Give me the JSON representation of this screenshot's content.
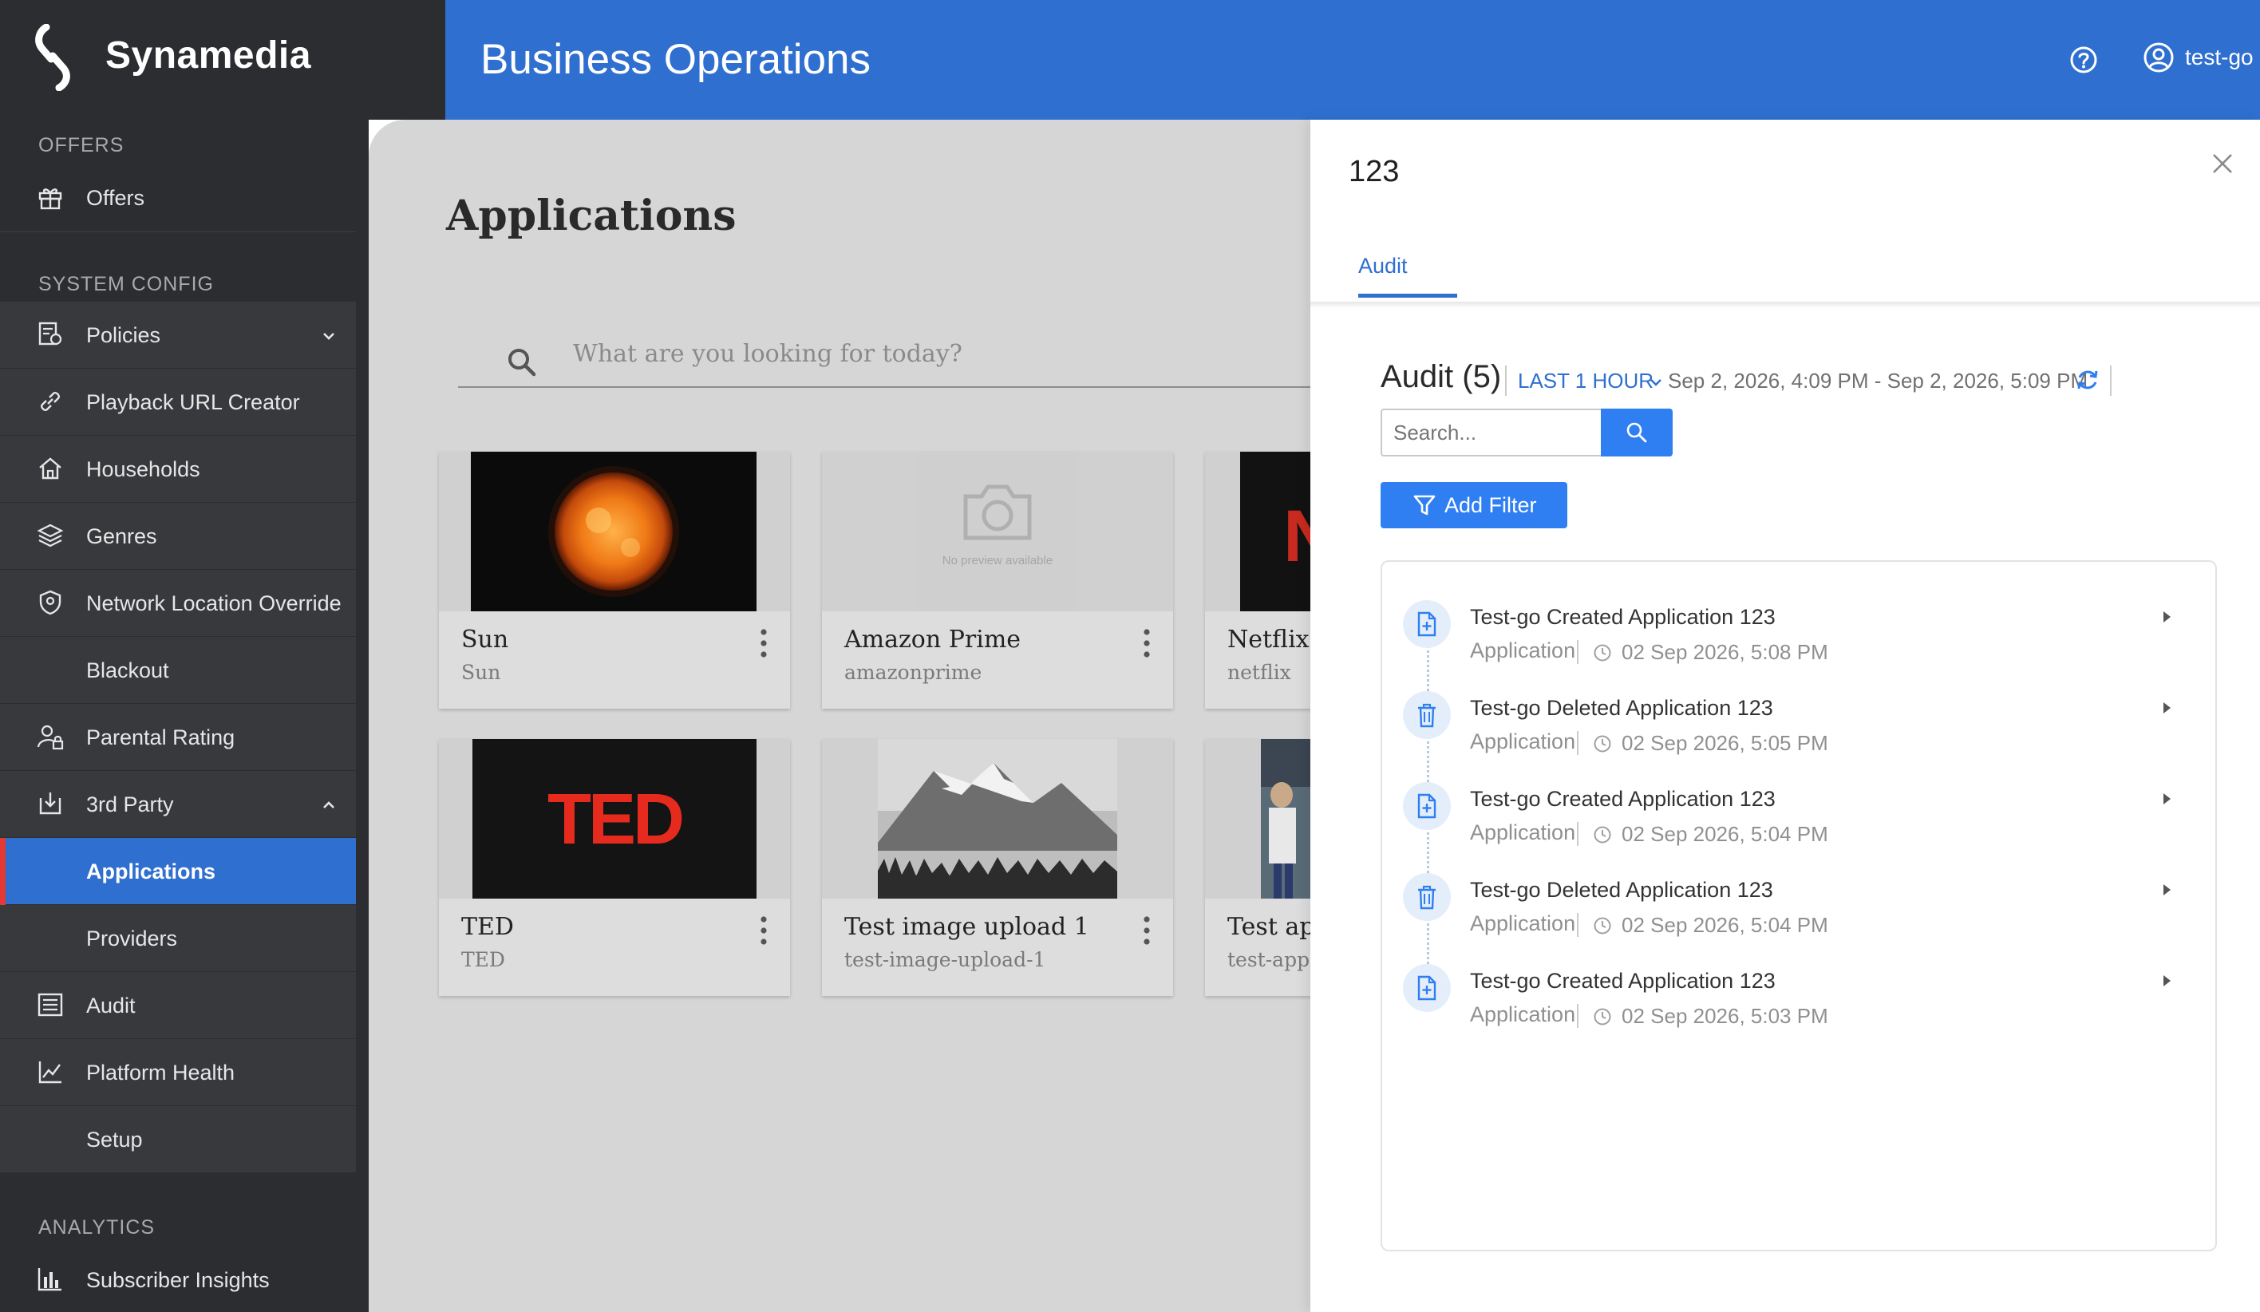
{
  "brand": {
    "name": "Synamedia"
  },
  "header": {
    "title": "Business Operations",
    "user": "test-go",
    "help_icon": "help-circle-icon",
    "user_icon": "user-circle-icon"
  },
  "sidebar": {
    "sections": {
      "offers": "OFFERS",
      "system_config": "SYSTEM CONFIG",
      "analytics": "ANALYTICS"
    },
    "offers_item": {
      "label": "Offers",
      "icon": "gift-icon"
    },
    "items": [
      {
        "label": "Policies",
        "icon": "policy-icon"
      },
      {
        "label": "Playback URL Creator",
        "icon": "link-icon"
      },
      {
        "label": "Households",
        "icon": "home-icon"
      },
      {
        "label": "Genres",
        "icon": "layers-icon"
      },
      {
        "label": "Network Location Override",
        "icon": "shield-icon"
      },
      {
        "label": "Blackout",
        "icon": ""
      },
      {
        "label": "Parental Rating",
        "icon": "user-lock-icon"
      },
      {
        "label": "3rd Party",
        "icon": "download-box-icon"
      },
      {
        "label": "Applications",
        "icon": ""
      },
      {
        "label": "Providers",
        "icon": ""
      },
      {
        "label": "Audit",
        "icon": "list-icon"
      },
      {
        "label": "Platform Health",
        "icon": "line-chart-icon"
      },
      {
        "label": "Setup",
        "icon": ""
      }
    ],
    "analytics_item": {
      "label": "Subscriber Insights",
      "icon": "bar-chart-icon"
    },
    "active": "Applications",
    "accent": "#2f6fcf"
  },
  "main": {
    "heading": "Applications",
    "search_placeholder": "What are you looking for today?",
    "cards": [
      {
        "title": "Sun",
        "sub": "Sun"
      },
      {
        "title": "Amazon Prime",
        "sub": "amazonprime",
        "placeholder": "No preview available"
      },
      {
        "title": "Netflix",
        "sub": "netflix",
        "logo": "N"
      },
      {
        "title": "TED",
        "sub": "TED",
        "logo": "TED"
      },
      {
        "title": "Test image upload 1",
        "sub": "test-image-upload-1"
      },
      {
        "title": "Test app",
        "sub": "test-appli"
      }
    ]
  },
  "panel": {
    "title": "123",
    "tab": "Audit",
    "audit_heading": "Audit (5)",
    "range_label": "LAST 1 HOUR",
    "range_text": "Sep 2, 2026, 4:09 PM - Sep 2, 2026, 5:09 PM",
    "search_placeholder": "Search...",
    "filter_label": "Add Filter",
    "events": [
      {
        "text": "Test-go Created Application 123",
        "category": "Application",
        "time": "02 Sep 2026, 5:08 PM",
        "icon": "file-plus-icon"
      },
      {
        "text": "Test-go Deleted Application 123",
        "category": "Application",
        "time": "02 Sep 2026, 5:05 PM",
        "icon": "trash-icon"
      },
      {
        "text": "Test-go Created Application 123",
        "category": "Application",
        "time": "02 Sep 2026, 5:04 PM",
        "icon": "file-plus-icon"
      },
      {
        "text": "Test-go Deleted Application 123",
        "category": "Application",
        "time": "02 Sep 2026, 5:04 PM",
        "icon": "trash-icon"
      },
      {
        "text": "Test-go Created Application 123",
        "category": "Application",
        "time": "02 Sep 2026, 5:03 PM",
        "icon": "file-plus-icon"
      }
    ]
  }
}
